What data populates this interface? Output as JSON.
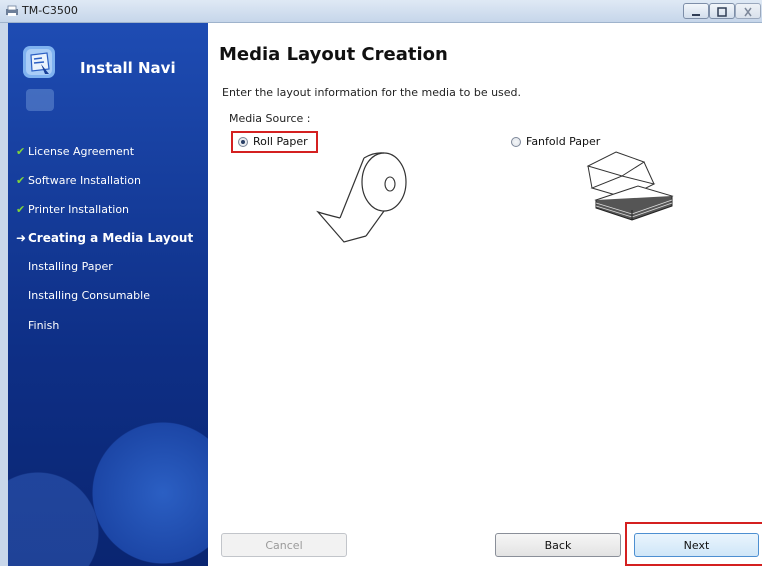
{
  "window": {
    "title": "TM-C3500"
  },
  "sidebar": {
    "brand": "Install Navi",
    "items": [
      {
        "label": "License Agreement",
        "state": "done"
      },
      {
        "label": "Software Installation",
        "state": "done"
      },
      {
        "label": "Printer Installation",
        "state": "done"
      },
      {
        "label": "Creating a Media Layout",
        "state": "current"
      },
      {
        "label": "Installing Paper",
        "state": "pending"
      },
      {
        "label": "Installing Consumable",
        "state": "pending"
      },
      {
        "label": "Finish",
        "state": "pending"
      }
    ]
  },
  "main": {
    "title": "Media Layout Creation",
    "description": "Enter the layout information for the media to be used.",
    "media_source_label": "Media Source :",
    "options": [
      {
        "label": "Roll Paper",
        "selected": true
      },
      {
        "label": "Fanfold Paper",
        "selected": false
      }
    ]
  },
  "buttons": {
    "cancel": "Cancel",
    "back": "Back",
    "next": "Next"
  },
  "colors": {
    "sidebar": "#1a43a0",
    "highlight": "#d42020",
    "check": "#7fd43a"
  }
}
